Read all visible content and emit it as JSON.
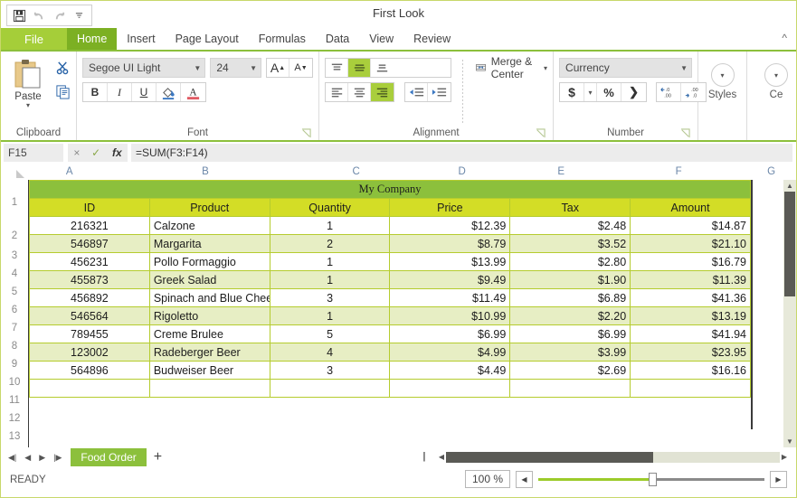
{
  "window": {
    "title": "First Look",
    "quick_access": [
      "save-icon",
      "undo-icon",
      "redo-icon",
      "customize-caret-icon"
    ],
    "ribbon_collapse": "^"
  },
  "tabs": [
    {
      "label": "File",
      "kind": "file"
    },
    {
      "label": "Home",
      "kind": "active"
    },
    {
      "label": "Insert",
      "kind": "normal"
    },
    {
      "label": "Page Layout",
      "kind": "normal"
    },
    {
      "label": "Formulas",
      "kind": "normal"
    },
    {
      "label": "Data",
      "kind": "normal"
    },
    {
      "label": "View",
      "kind": "normal"
    },
    {
      "label": "Review",
      "kind": "normal"
    }
  ],
  "ribbon": {
    "clipboard": {
      "label": "Clipboard",
      "paste_label": "Paste",
      "paste_caret": "▾",
      "cut_icon": "scissors-icon",
      "copy_icon": "copy-icon"
    },
    "font": {
      "label": "Font",
      "font_name": "Segoe UI Light",
      "font_size": "24",
      "grow_label": "A",
      "shrink_label": "A",
      "bold": "B",
      "italic": "I",
      "underline": "U",
      "fill_color_icon": "fill-color-icon",
      "font_color_icon": "font-color-icon"
    },
    "alignment": {
      "label": "Alignment",
      "merge_label": "Merge & Center",
      "merge_caret": "▾",
      "valign": [
        "top-align-icon",
        "middle-align-icon",
        "bottom-align-icon"
      ],
      "halign": [
        "align-left-icon",
        "align-center-icon",
        "align-right-icon"
      ],
      "indent": [
        "decrease-indent-icon",
        "increase-indent-icon"
      ],
      "active_valign": 1,
      "active_halign": 2
    },
    "number": {
      "label": "Number",
      "format": "Currency",
      "format_caret": "▾",
      "currency": "$",
      "currency_caret": "▾",
      "percent": "%",
      "comma": "❯",
      "inc_decimal": ".00",
      "dec_decimal": ".00"
    },
    "styles": {
      "label": "Styles",
      "caret": "▾"
    },
    "cells": {
      "label": "Ce",
      "caret": "▾"
    }
  },
  "formula_bar": {
    "name_box": "F15",
    "cancel_icon": "×",
    "accept_icon": "✓",
    "function_icon": "fx",
    "formula": "=SUM(F3:F14)"
  },
  "grid": {
    "column_headers": [
      "A",
      "B",
      "C",
      "D",
      "E",
      "F",
      "G"
    ],
    "row_numbers": [
      "1",
      "2",
      "3",
      "4",
      "5",
      "6",
      "7",
      "8",
      "9",
      "10",
      "11",
      "12",
      "13"
    ],
    "banner_title": "My Company",
    "headers": [
      "ID",
      "Product",
      "Quantity",
      "Price",
      "Tax",
      "Amount"
    ],
    "rows": [
      {
        "id": "216321",
        "product": "Calzone",
        "quantity": "1",
        "price": "$12.39",
        "tax": "$2.48",
        "amount": "$14.87"
      },
      {
        "id": "546897",
        "product": "Margarita",
        "quantity": "2",
        "price": "$8.79",
        "tax": "$3.52",
        "amount": "$21.10"
      },
      {
        "id": "456231",
        "product": "Pollo Formaggio",
        "quantity": "1",
        "price": "$13.99",
        "tax": "$2.80",
        "amount": "$16.79"
      },
      {
        "id": "455873",
        "product": "Greek Salad",
        "quantity": "1",
        "price": "$9.49",
        "tax": "$1.90",
        "amount": "$11.39"
      },
      {
        "id": "456892",
        "product": "Spinach and Blue Cheese",
        "quantity": "3",
        "price": "$11.49",
        "tax": "$6.89",
        "amount": "$41.36"
      },
      {
        "id": "546564",
        "product": "Rigoletto",
        "quantity": "1",
        "price": "$10.99",
        "tax": "$2.20",
        "amount": "$13.19"
      },
      {
        "id": "789455",
        "product": "Creme Brulee",
        "quantity": "5",
        "price": "$6.99",
        "tax": "$6.99",
        "amount": "$41.94"
      },
      {
        "id": "123002",
        "product": "Radeberger Beer",
        "quantity": "4",
        "price": "$4.99",
        "tax": "$3.99",
        "amount": "$23.95"
      },
      {
        "id": "564896",
        "product": "Budweiser Beer",
        "quantity": "3",
        "price": "$4.49",
        "tax": "$2.69",
        "amount": "$16.16"
      }
    ]
  },
  "sheet_bar": {
    "first_icon": "◀|",
    "prev_icon": "◀",
    "next_icon": "▶",
    "last_icon": "|▶",
    "sheets": [
      "Food Order"
    ],
    "add_label": "+"
  },
  "status_bar": {
    "status": "READY",
    "zoom_percent": "100 %",
    "zoom_out": "◀",
    "zoom_in": "▶"
  },
  "colors": {
    "accent_green": "#8cc03c",
    "file_green": "#a5ce39",
    "active_tab": "#7cb023",
    "header_yellow": "#d3dd26",
    "band": "#e7eec4",
    "cell_border": "#b5cc2e"
  }
}
